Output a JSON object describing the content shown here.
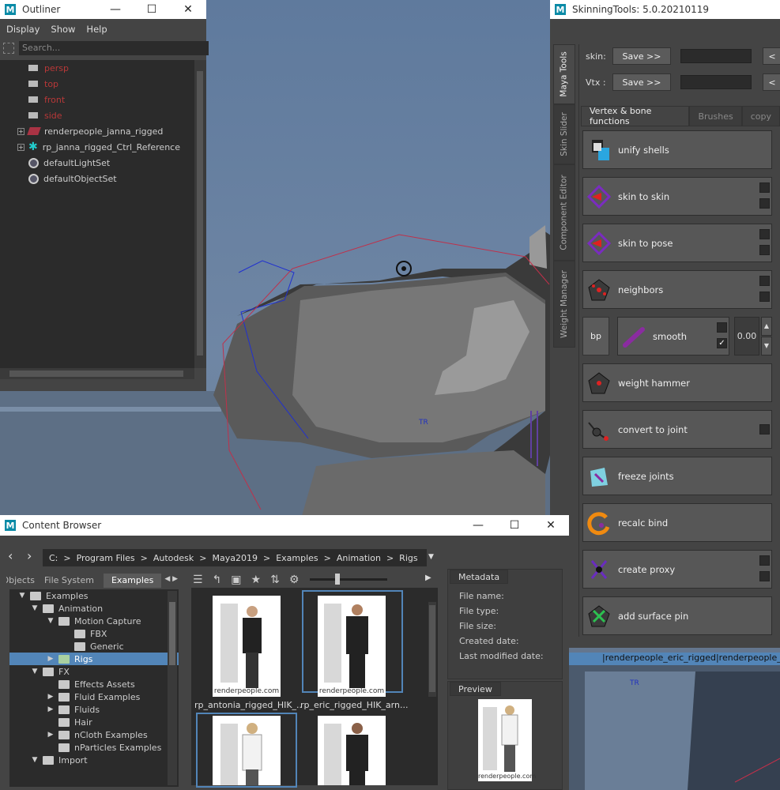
{
  "outliner": {
    "title": "Outliner",
    "menu": [
      "Display",
      "Show",
      "Help"
    ],
    "search_placeholder": "Search...",
    "items": [
      {
        "label": "persp",
        "type": "camera"
      },
      {
        "label": "top",
        "type": "camera"
      },
      {
        "label": "front",
        "type": "camera"
      },
      {
        "label": "side",
        "type": "camera"
      },
      {
        "label": "renderpeople_janna_rigged",
        "type": "mesh"
      },
      {
        "label": "rp_janna_rigged_Ctrl_Reference",
        "type": "reference"
      },
      {
        "label": "defaultLightSet",
        "type": "set"
      },
      {
        "label": "defaultObjectSet",
        "type": "set"
      }
    ]
  },
  "viewport": {
    "label_tr": "TR",
    "label_tr2": "TR",
    "hud_path": "|renderpeople_eric_rigged|renderpeople_er"
  },
  "skinning": {
    "title": "SkinningTools: 5.0.20210119",
    "side_tabs": [
      "Maya Tools",
      "Skin Slider",
      "Component Editor",
      "Weight Manager"
    ],
    "skin_label": "skin:",
    "vtx_label": "Vtx :",
    "save_label": "Save >>",
    "arrow_label": "<",
    "tabs": [
      "Vertex & bone functions",
      "Brushes",
      "copy"
    ],
    "tools": [
      {
        "label": "unify shells"
      },
      {
        "label": "skin to skin"
      },
      {
        "label": "skin to pose"
      },
      {
        "label": "neighbors"
      },
      {
        "label": "smooth"
      },
      {
        "label": "weight hammer"
      },
      {
        "label": "convert to joint"
      },
      {
        "label": "freeze joints"
      },
      {
        "label": "recalc bind"
      },
      {
        "label": "create proxy"
      },
      {
        "label": "add surface pin"
      }
    ],
    "bp_label": "bp",
    "smooth_value": "0.00"
  },
  "content_browser": {
    "title": "Content Browser",
    "breadcrumbs": [
      "C:",
      ">",
      "Program Files",
      ">",
      "Autodesk",
      ">",
      "Maya2019",
      ">",
      "Examples",
      ">",
      "Animation",
      ">",
      "Rigs"
    ],
    "tabs": [
      "Objects",
      "File System",
      "Examples"
    ],
    "tree": [
      {
        "label": "Examples",
        "level": 0,
        "arrow": "▼"
      },
      {
        "label": "Animation",
        "level": 1,
        "arrow": "▼"
      },
      {
        "label": "Motion Capture",
        "level": 2,
        "arrow": "▼"
      },
      {
        "label": "FBX",
        "level": 3,
        "arrow": ""
      },
      {
        "label": "Generic",
        "level": 3,
        "arrow": ""
      },
      {
        "label": "Rigs",
        "level": 2,
        "arrow": "▶",
        "selected": true
      },
      {
        "label": "FX",
        "level": 1,
        "arrow": "▼"
      },
      {
        "label": "Effects Assets",
        "level": 2,
        "arrow": ""
      },
      {
        "label": "Fluid Examples",
        "level": 2,
        "arrow": "▶"
      },
      {
        "label": "Fluids",
        "level": 2,
        "arrow": "▶"
      },
      {
        "label": "Hair",
        "level": 2,
        "arrow": ""
      },
      {
        "label": "nCloth Examples",
        "level": 2,
        "arrow": "▶"
      },
      {
        "label": "nParticles Examples",
        "level": 2,
        "arrow": ""
      },
      {
        "label": "Import",
        "level": 1,
        "arrow": "▼"
      }
    ],
    "thumbs": [
      {
        "caption": "rp_antonia_rigged_HIK_...",
        "watermark": "renderpeople.com"
      },
      {
        "caption": "rp_eric_rigged_HIK_arn...",
        "watermark": "renderpeople.com"
      },
      {
        "caption": "",
        "watermark": ""
      },
      {
        "caption": "",
        "watermark": ""
      }
    ],
    "metadata_title": "Metadata",
    "metadata": [
      "File name:",
      "File type:",
      "File size:",
      "Created date:",
      "Last modified date:"
    ],
    "preview_title": "Preview",
    "preview_watermark": "renderpeople.com"
  }
}
